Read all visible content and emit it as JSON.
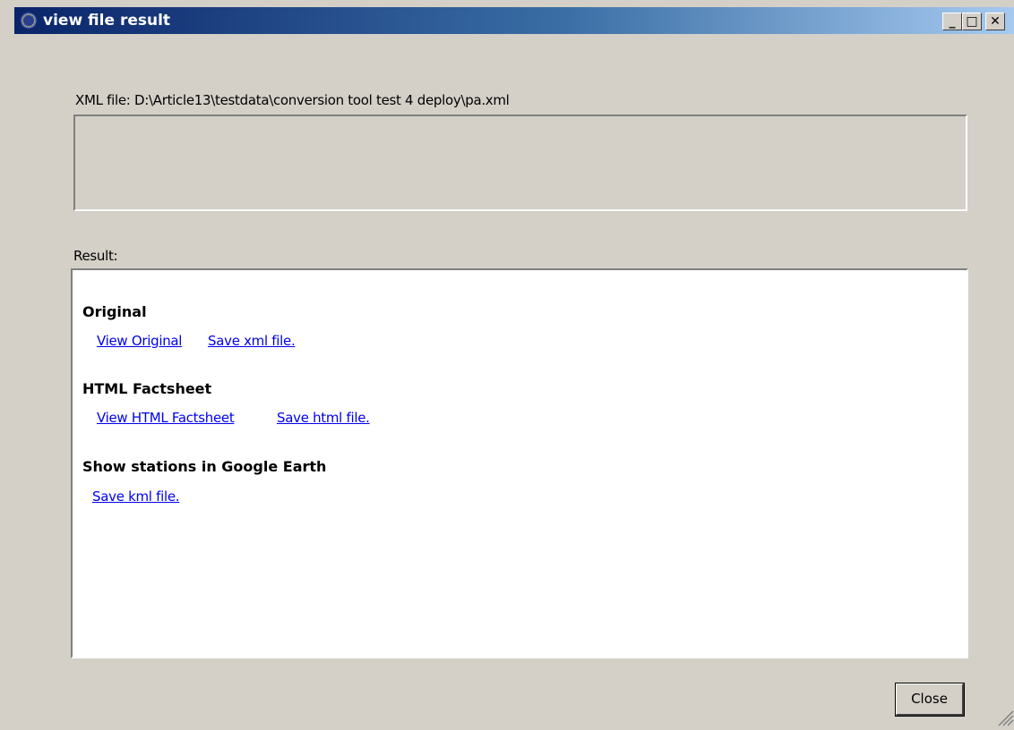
{
  "window": {
    "title": "view file result",
    "minimize_glyph": "_",
    "maximize_glyph": "□",
    "close_glyph": "✕"
  },
  "xml_file": {
    "label": "XML file: D:\\Article13\\testdata\\conversion tool test 4 deploy\\pa.xml"
  },
  "result": {
    "label": "Result:",
    "sections": [
      {
        "title": "Original",
        "links": [
          "View Original",
          "Save xml file."
        ]
      },
      {
        "title": "HTML Factsheet",
        "links": [
          "View HTML Factsheet",
          "Save html file."
        ]
      },
      {
        "title": "Show stations in Google Earth",
        "links": [
          "Save kml file."
        ]
      }
    ]
  },
  "buttons": {
    "close_label": "Close"
  }
}
